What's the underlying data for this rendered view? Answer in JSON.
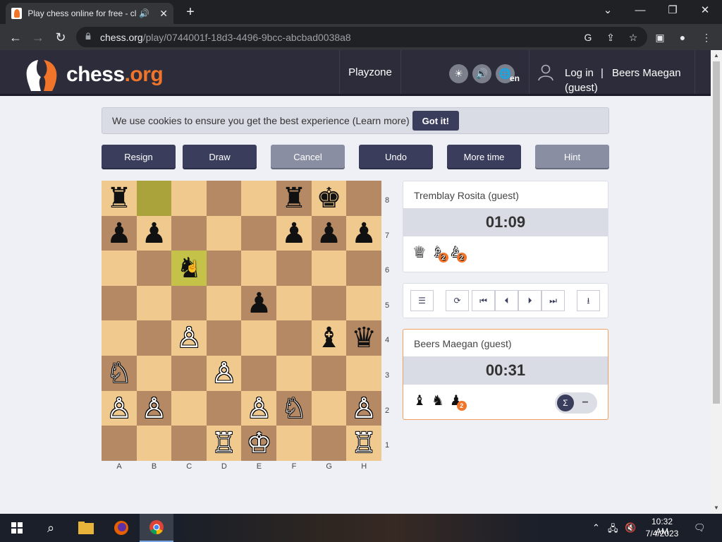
{
  "browser": {
    "tab_title": "Play chess online for free - cl",
    "tab_audio_icon": "speaker-icon",
    "url_domain": "chess.org",
    "url_path": "/play/0744001f-18d3-4496-9bcc-abcbad0038a8"
  },
  "header": {
    "logo_prefix": "chess",
    "logo_suffix": ".org",
    "nav_playzone": "Playzone",
    "lang_code": "en",
    "login": "Log in",
    "separator": "|",
    "username": "Beers Maegan",
    "username_sub": "(guest)"
  },
  "cookie": {
    "text": "We use cookies to ensure you get the best experience",
    "learn_more": "(Learn more)",
    "button": "Got it!"
  },
  "actions": {
    "resign": "Resign",
    "draw": "Draw",
    "cancel": "Cancel",
    "undo": "Undo",
    "more_time": "More time",
    "hint": "Hint"
  },
  "board": {
    "files": [
      "A",
      "B",
      "C",
      "D",
      "E",
      "F",
      "G",
      "H"
    ],
    "ranks": [
      "8",
      "7",
      "6",
      "5",
      "4",
      "3",
      "2",
      "1"
    ],
    "highlight_last_move": [
      "b8",
      "c6"
    ],
    "pieces": [
      {
        "sq": "a8",
        "glyph": "♜",
        "color": "b",
        "name": "black-rook"
      },
      {
        "sq": "f8",
        "glyph": "♜",
        "color": "b",
        "name": "black-rook"
      },
      {
        "sq": "g8",
        "glyph": "♚",
        "color": "b",
        "name": "black-king"
      },
      {
        "sq": "a7",
        "glyph": "♟",
        "color": "b",
        "name": "black-pawn"
      },
      {
        "sq": "b7",
        "glyph": "♟",
        "color": "b",
        "name": "black-pawn"
      },
      {
        "sq": "f7",
        "glyph": "♟",
        "color": "b",
        "name": "black-pawn"
      },
      {
        "sq": "g7",
        "glyph": "♟",
        "color": "b",
        "name": "black-pawn"
      },
      {
        "sq": "h7",
        "glyph": "♟",
        "color": "b",
        "name": "black-pawn"
      },
      {
        "sq": "c6",
        "glyph": "♞",
        "color": "b",
        "name": "black-knight"
      },
      {
        "sq": "e5",
        "glyph": "♟",
        "color": "b",
        "name": "black-pawn"
      },
      {
        "sq": "c4",
        "glyph": "♙",
        "color": "w",
        "name": "white-pawn"
      },
      {
        "sq": "g4",
        "glyph": "♝",
        "color": "b",
        "name": "black-bishop"
      },
      {
        "sq": "h4",
        "glyph": "♛",
        "color": "b",
        "name": "black-queen"
      },
      {
        "sq": "a3",
        "glyph": "♘",
        "color": "w",
        "name": "white-knight"
      },
      {
        "sq": "d3",
        "glyph": "♙",
        "color": "w",
        "name": "white-pawn"
      },
      {
        "sq": "a2",
        "glyph": "♙",
        "color": "w",
        "name": "white-pawn"
      },
      {
        "sq": "b2",
        "glyph": "♙",
        "color": "w",
        "name": "white-pawn"
      },
      {
        "sq": "e2",
        "glyph": "♙",
        "color": "w",
        "name": "white-pawn"
      },
      {
        "sq": "f2",
        "glyph": "♘",
        "color": "w",
        "name": "white-knight"
      },
      {
        "sq": "h2",
        "glyph": "♙",
        "color": "w",
        "name": "white-pawn"
      },
      {
        "sq": "d1",
        "glyph": "♖",
        "color": "w",
        "name": "white-rook"
      },
      {
        "sq": "e1",
        "glyph": "♔",
        "color": "w",
        "name": "white-king"
      },
      {
        "sq": "h1",
        "glyph": "♖",
        "color": "w",
        "name": "white-rook"
      }
    ]
  },
  "opponent": {
    "name": "Tremblay Rosita (guest)",
    "clock": "01:09",
    "captured": [
      {
        "glyph": "♕",
        "badge": ""
      },
      {
        "glyph": "♗",
        "badge": "2"
      },
      {
        "glyph": "♙",
        "badge": "2"
      }
    ]
  },
  "player": {
    "name": "Beers Maegan (guest)",
    "clock": "00:31",
    "captured": [
      {
        "glyph": "♝",
        "badge": ""
      },
      {
        "glyph": "♞",
        "badge": ""
      },
      {
        "glyph": "♟",
        "badge": "2"
      }
    ],
    "sigma_label": "Σ",
    "minus_label": "−"
  },
  "taskbar": {
    "time": "10:32 AM",
    "date": "7/4/2023"
  },
  "colors": {
    "accent_orange": "#f0752b",
    "header_bg": "#2c2c3a",
    "button_dark": "#3a3d5c",
    "button_light": "#8a8ea2",
    "board_light": "#f0c98e",
    "board_dark": "#b58963"
  }
}
